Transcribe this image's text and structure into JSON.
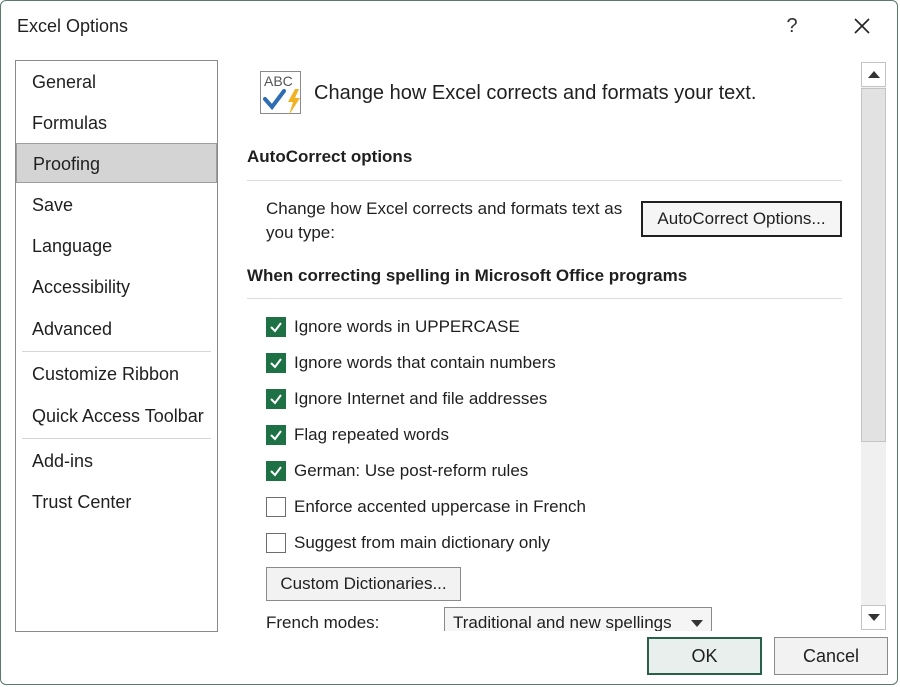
{
  "window": {
    "title": "Excel Options",
    "help_glyph": "?",
    "close_icon": "close-icon"
  },
  "nav": {
    "items": [
      {
        "label": "General"
      },
      {
        "label": "Formulas"
      },
      {
        "label": "Proofing",
        "selected": true
      },
      {
        "label": "Save"
      },
      {
        "label": "Language"
      },
      {
        "label": "Accessibility"
      },
      {
        "label": "Advanced"
      },
      {
        "label": "Customize Ribbon"
      },
      {
        "label": "Quick Access Toolbar"
      },
      {
        "label": "Add-ins"
      },
      {
        "label": "Trust Center"
      }
    ]
  },
  "content": {
    "header_text": "Change how Excel corrects and formats your text.",
    "header_icon_text": "ABC",
    "autocorrect": {
      "title": "AutoCorrect options",
      "description": "Change how Excel corrects and formats text as you type:",
      "button_label": "AutoCorrect Options..."
    },
    "spelling": {
      "title": "When correcting spelling in Microsoft Office programs",
      "options": [
        {
          "label": "Ignore words in UPPERCASE",
          "checked": true
        },
        {
          "label": "Ignore words that contain numbers",
          "checked": true
        },
        {
          "label": "Ignore Internet and file addresses",
          "checked": true
        },
        {
          "label": "Flag repeated words",
          "checked": true
        },
        {
          "label": "German: Use post-reform rules",
          "checked": true
        },
        {
          "label": "Enforce accented uppercase in French",
          "checked": false
        },
        {
          "label": "Suggest from main dictionary only",
          "checked": false
        }
      ],
      "custom_dictionaries_label": "Custom Dictionaries...",
      "french_modes_label": "French modes:",
      "french_modes_value": "Traditional and new spellings"
    }
  },
  "footer": {
    "ok_label": "OK",
    "cancel_label": "Cancel"
  },
  "colors": {
    "accent": "#1e7145",
    "selected_nav": "#d4d4d4"
  }
}
